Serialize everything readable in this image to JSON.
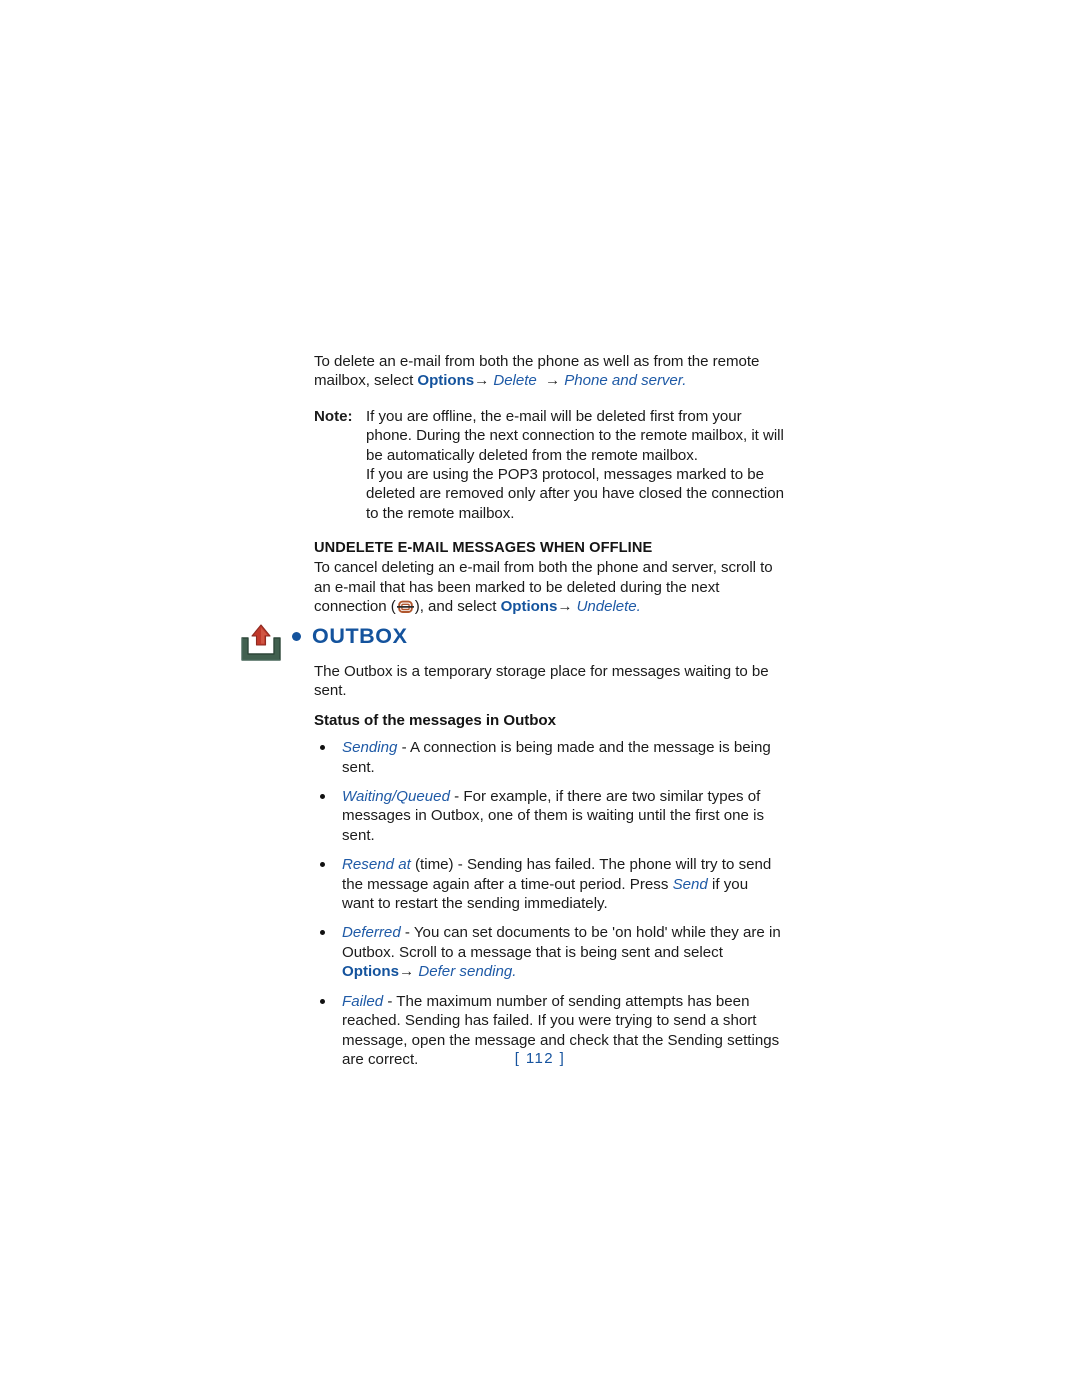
{
  "document": {
    "page_number": "112",
    "page_number_display": "[ 112 ]",
    "colors": {
      "heading_blue": "#14539d",
      "link_blue": "#1f5aa6",
      "body_black": "#1b1b1b",
      "tray_icon_green": "#3c5c4b",
      "tray_icon_arrow_red": "#c0392b",
      "mail_icon_brown": "#b0572e",
      "page_background": "#ffffff"
    }
  },
  "intro": {
    "line_start": "To delete an e-mail from both the phone as well as from the remote mailbox, select ",
    "options_label": "Options",
    "arrow1": "→",
    "delete_label": "Delete",
    "arrow2": "→",
    "phone_and_server_label": "Phone and server."
  },
  "note": {
    "label": "Note:",
    "paragraphs": [
      "If you are offline, the e-mail will be deleted first from your phone. During the next connection to the remote mailbox, it will be automatically deleted from the remote mailbox.",
      "If you are using the POP3 protocol, messages marked to be deleted are removed only after you have closed the connection to the remote mailbox."
    ]
  },
  "undelete_section": {
    "heading": "UNDELETE E-MAIL MESSAGES WHEN OFFLINE",
    "body_before_icon": "To cancel deleting an e-mail from both the phone and server, scroll to an e-mail that has been marked to be deleted during the next connection (",
    "icon_name": "deleted-mail-icon",
    "body_after_icon": "), and select ",
    "options_label": "Options",
    "arrow": "→",
    "undelete_label": "Undelete."
  },
  "outbox_section": {
    "icon_name": "outbox-tray-icon",
    "bullet_glyph": "•",
    "heading": "OUTBOX",
    "intro": "The Outbox is a temporary storage place for messages waiting to be sent.",
    "status_heading": "Status of the messages in Outbox",
    "status_items": [
      {
        "term": "Sending",
        "text": " - A connection is being made and the message is being sent."
      },
      {
        "term": "Waiting/Queued",
        "text": " - For example, if there are two similar types of messages in Outbox, one of them is waiting until the first one is sent."
      },
      {
        "term": "Resend at",
        "text_part1": " (time) - Sending has failed. The phone will try to send the message again after a time-out period. Press ",
        "emphasis": "Send",
        "text_part2": " if you want to restart the sending immediately."
      },
      {
        "term": "Deferred",
        "text_part1": " - You can set documents to be 'on hold' while they are in Outbox. Scroll to a message that is being sent and select ",
        "options_label": "Options",
        "arrow": "→",
        "emphasis2": "Defer sending."
      },
      {
        "term": "Failed",
        "text": " - The maximum number of sending attempts has been reached. Sending has failed. If you were trying to send a short message, open the message and check that the Sending settings are correct."
      }
    ]
  }
}
